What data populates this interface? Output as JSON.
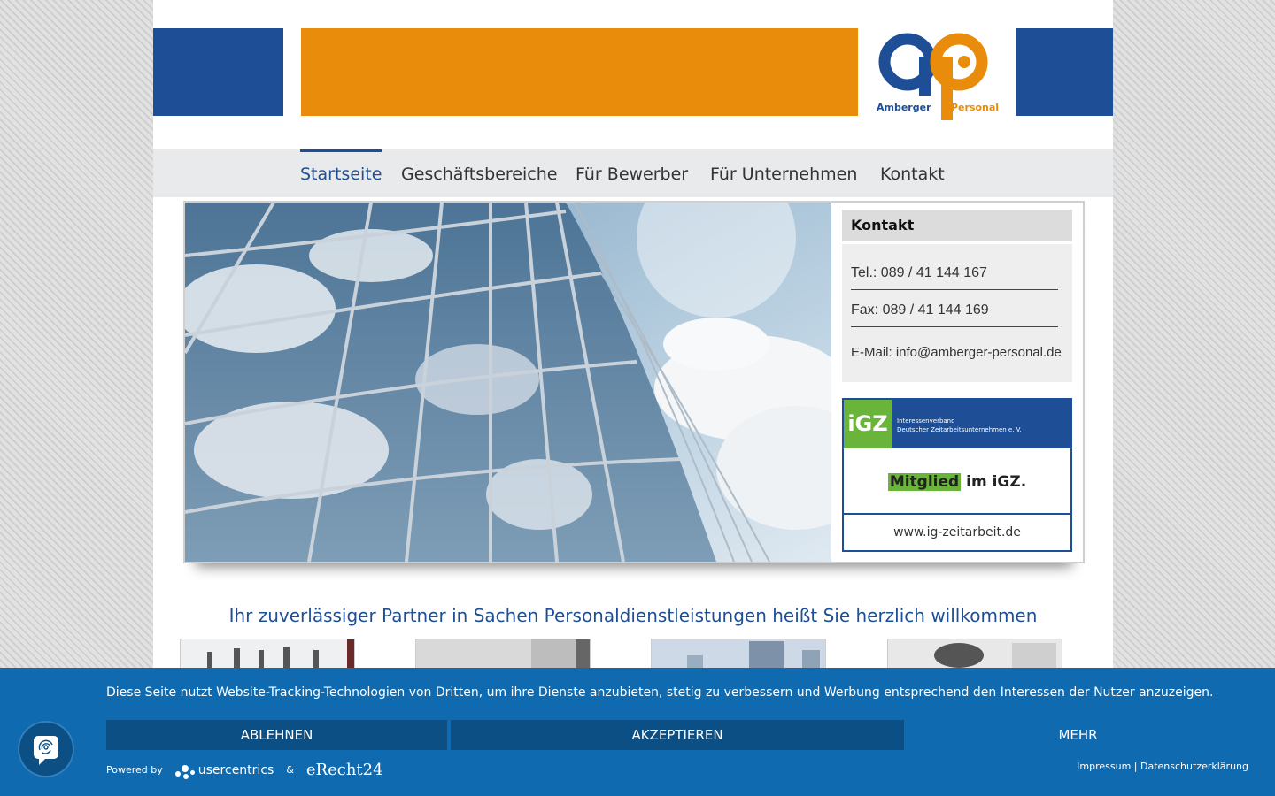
{
  "brand": {
    "logo_left": "Amberger",
    "logo_right": "Personal",
    "blue": "#1e4f96",
    "orange": "#ea8c0b"
  },
  "nav": {
    "items": [
      "Startseite",
      "Geschäftsbereiche",
      "Für Bewerber",
      "Für Unternehmen",
      "Kontakt"
    ],
    "active": "Startseite"
  },
  "kontakt": {
    "title": "Kontakt",
    "tel": "Tel.: 089 / 41 144 167",
    "fax": "Fax: 089 / 41 144 169",
    "email_label": "E-Mail:",
    "email": "info@amberger-personal.de"
  },
  "igz": {
    "logo": "iGZ",
    "line1": "Interessenverband",
    "line2": "Deutscher Zeitarbeitsunternehmen e. V.",
    "member_word": "Mitglied",
    "member_rest": " im iGZ.",
    "url": "www.ig-zeitarbeit.de"
  },
  "headline": "Ihr zuverlässiger Partner in Sachen Personaldienstleistungen heißt Sie herzlich willkommen",
  "consent": {
    "text": "Diese Seite nutzt Website-Tracking-Technologien von Dritten, um ihre Dienste anzubieten, stetig zu verbessern und Werbung entsprechend den Interessen der Nutzer anzuzeigen.",
    "decline": "ABLEHNEN",
    "accept": "AKZEPTIEREN",
    "more": "MEHR",
    "powered_by": "Powered by",
    "usercentrics": "usercentrics",
    "amp": "&",
    "erecht": "eRecht24",
    "impressum": "Impressum",
    "separator": "|",
    "privacy": "Datenschutzerklärung"
  }
}
